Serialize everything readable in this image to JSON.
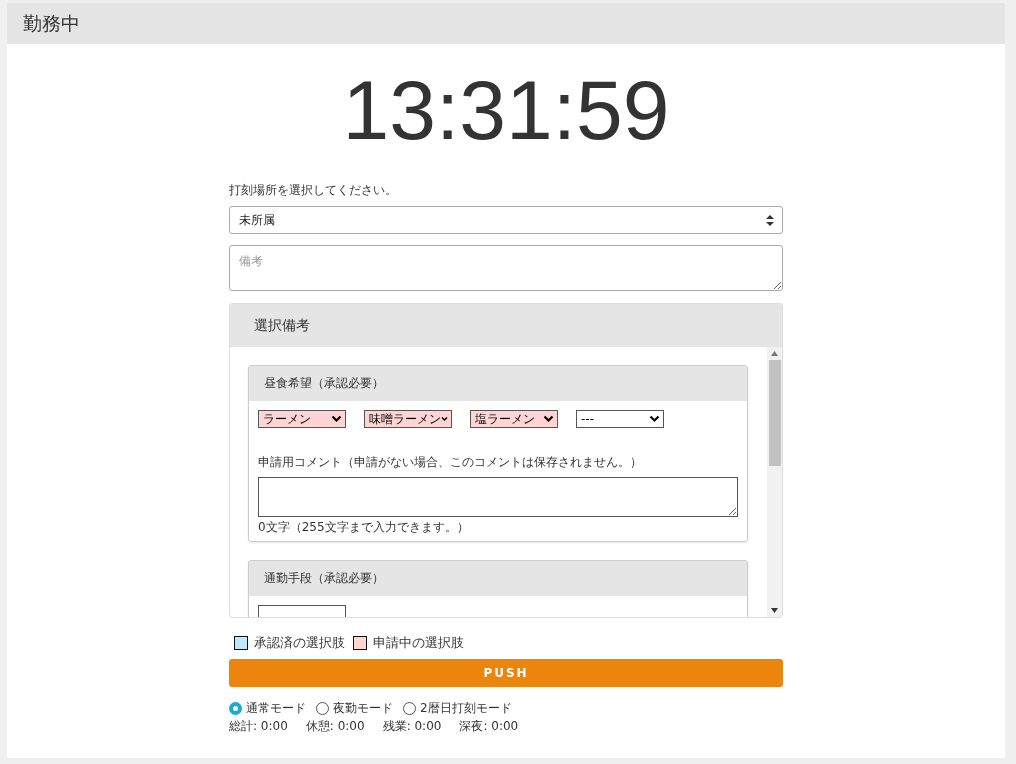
{
  "header": {
    "title": "勤務中"
  },
  "clock": "13:31:59",
  "location": {
    "label": "打刻場所を選択してください。",
    "value": "未所属"
  },
  "remarks": {
    "placeholder": "備考"
  },
  "choice_panel": {
    "title": "選択備考",
    "sections": [
      {
        "title": "昼食希望（承認必要）",
        "selects": [
          {
            "value": "ラーメン",
            "pending": true
          },
          {
            "value": "味噌ラーメン",
            "pending": true
          },
          {
            "value": "塩ラーメン",
            "pending": true
          },
          {
            "value": "---",
            "pending": false
          }
        ],
        "comment_label": "申請用コメント（申請がない場合、このコメントは保存されません。）",
        "counter": "0文字（255文字まで入力できます。）"
      },
      {
        "title": "通勤手段（承認必要）",
        "selects": [
          {
            "pending": false
          }
        ]
      }
    ]
  },
  "legend": [
    {
      "label": "承認済の選択肢",
      "color": "#bfe9fb"
    },
    {
      "label": "申請中の選択肢",
      "color": "#ffd4d4"
    }
  ],
  "push_button": "PUSH",
  "modes": [
    {
      "label": "通常モード",
      "selected": true
    },
    {
      "label": "夜勤モード",
      "selected": false
    },
    {
      "label": "2暦日打刻モード",
      "selected": false
    }
  ],
  "totals": [
    "総計: 0:00",
    "休憩: 0:00",
    "残業: 0:00",
    "深夜: 0:00"
  ]
}
